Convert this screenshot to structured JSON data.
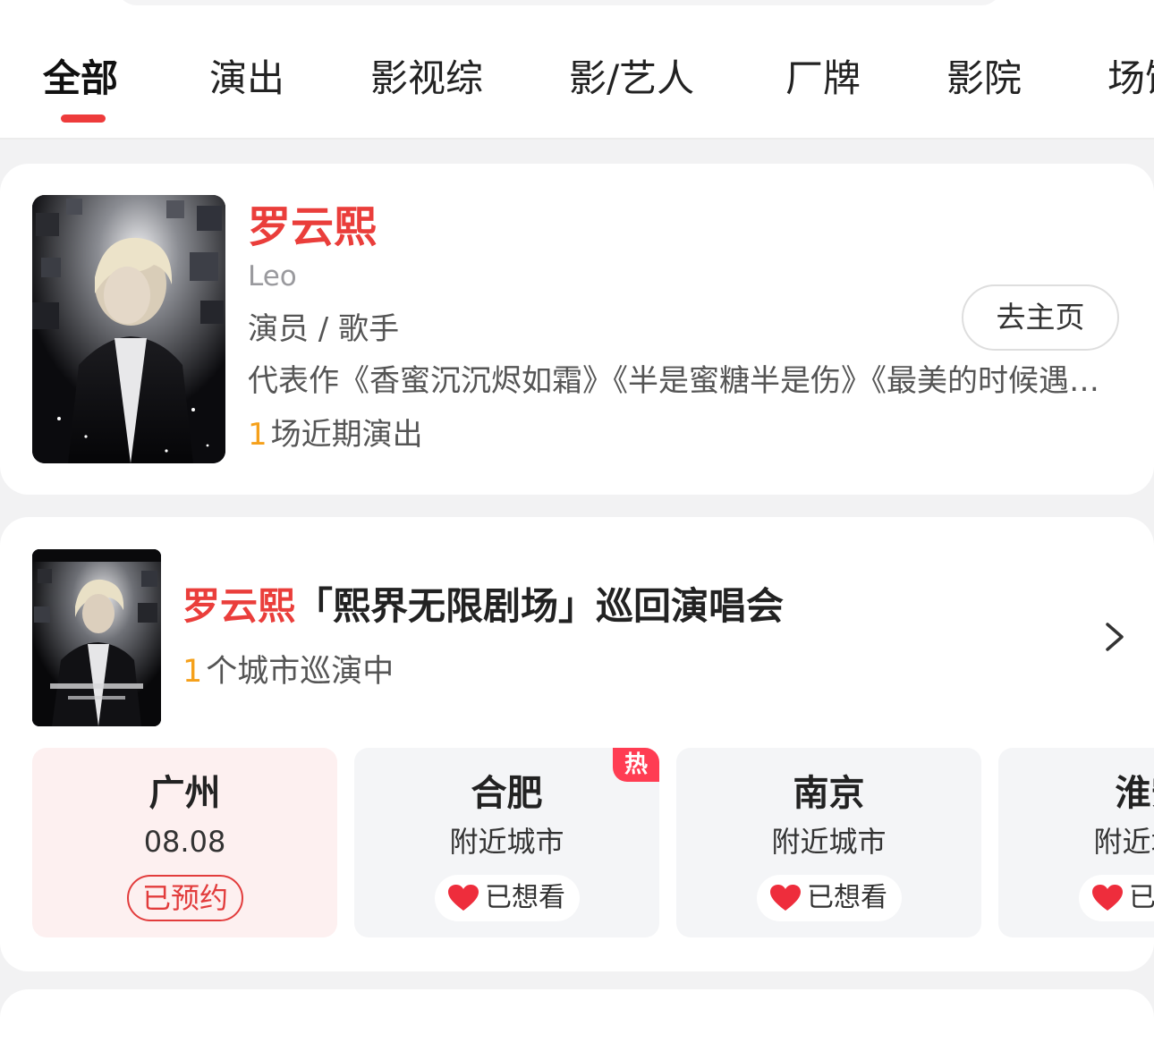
{
  "tabs": [
    "全部",
    "演出",
    "影视综",
    "影/艺人",
    "厂牌",
    "影院",
    "场馆"
  ],
  "artist": {
    "name": "罗云熙",
    "name_en": "Leo",
    "role": "演员 / 歌手",
    "works": "代表作《香蜜沉沉烬如霜》《半是蜜糖半是伤》《最美的时候遇见你》",
    "shows_count": "1",
    "shows_text": "场近期演出",
    "home_button": "去主页"
  },
  "tour": {
    "title_artist": "罗云熙",
    "title_rest": "「熙界无限剧场」巡回演唱会",
    "cities_count": "1",
    "cities_text": "个城市巡演中",
    "cities": [
      {
        "name": "广州",
        "sub": "08.08",
        "action": "已预约"
      },
      {
        "name": "合肥",
        "sub": "附近城市",
        "action": "已想看",
        "badge": "热"
      },
      {
        "name": "南京",
        "sub": "附近城市",
        "action": "已想看"
      },
      {
        "name": "淮安",
        "sub": "附近城市",
        "action": "已想看"
      }
    ]
  },
  "colors": {
    "accent": "#ea3e3b",
    "count": "#f5a01a",
    "hot_badge": "#ff3d53",
    "selected_city_bg": "#fdf0f0",
    "city_bg": "#f4f5f7"
  },
  "icons": {
    "chevron": "chevron-right-icon",
    "heart": "heart-icon"
  }
}
